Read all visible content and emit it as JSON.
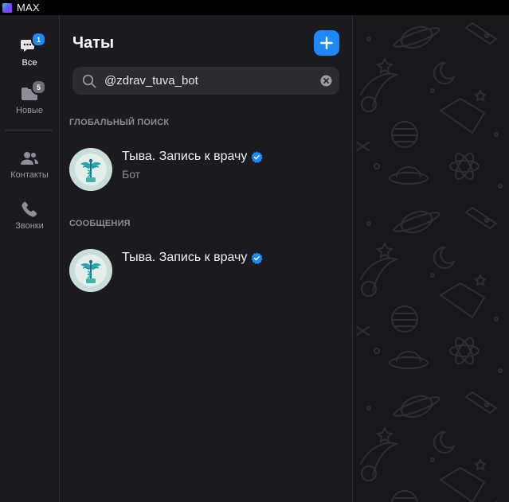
{
  "window": {
    "title": "MAX"
  },
  "sidebar": {
    "items": [
      {
        "label": "Все",
        "badge": "1",
        "icon": "chat-bubbles-icon",
        "active": true
      },
      {
        "label": "Новые",
        "badge": "5",
        "icon": "folder-icon",
        "active": false
      },
      {
        "label": "Контакты",
        "badge": "",
        "icon": "contacts-icon",
        "active": false
      },
      {
        "label": "Звонки",
        "badge": "",
        "icon": "phone-icon",
        "active": false
      }
    ]
  },
  "chat_list": {
    "title": "Чаты",
    "search": {
      "value": "@zdrav_tuva_bot",
      "placeholder": ""
    },
    "global_search_header": "ГЛОБАЛЬНЫЙ ПОИСК",
    "global_results": [
      {
        "title": "Тыва. Запись к врачу",
        "subtitle": "Бот",
        "verified": true
      }
    ],
    "messages_header": "СООБЩЕНИЯ",
    "message_results": [
      {
        "title": "Тыва. Запись к врачу",
        "subtitle": "",
        "verified": true
      }
    ]
  },
  "colors": {
    "accent": "#1e88ff",
    "background": "#1b1b1f",
    "wallpaper": "#18181b",
    "badge_gray": "#6e6e76"
  }
}
